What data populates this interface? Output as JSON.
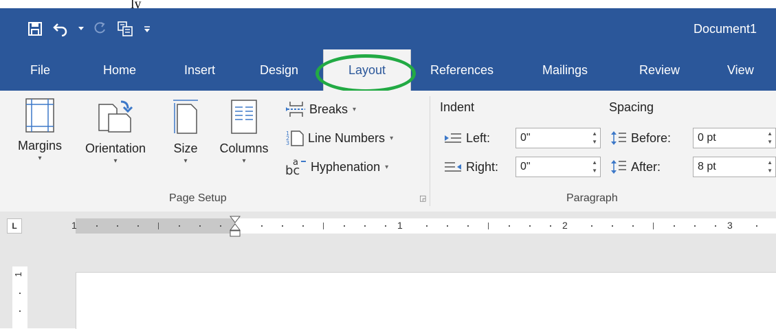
{
  "caption_fragment": "ly",
  "window": {
    "title": "Document1"
  },
  "tabs": [
    {
      "label": "File"
    },
    {
      "label": "Home"
    },
    {
      "label": "Insert"
    },
    {
      "label": "Design"
    },
    {
      "label": "Layout"
    },
    {
      "label": "References"
    },
    {
      "label": "Mailings"
    },
    {
      "label": "Review"
    },
    {
      "label": "View"
    }
  ],
  "active_tab": "Layout",
  "page_setup": {
    "margins": "Margins",
    "orientation": "Orientation",
    "size": "Size",
    "columns": "Columns",
    "breaks": "Breaks",
    "line_numbers": "Line Numbers",
    "hyphenation": "Hyphenation",
    "group_label": "Page Setup"
  },
  "paragraph": {
    "indent_header": "Indent",
    "spacing_header": "Spacing",
    "left_label": "Left:",
    "right_label": "Right:",
    "before_label": "Before:",
    "after_label": "After:",
    "left_value": "0\"",
    "right_value": "0\"",
    "before_value": "0 pt",
    "after_value": "8 pt",
    "group_label": "Paragraph"
  },
  "ruler": {
    "selector": "L",
    "numbers": [
      "1",
      "1",
      "2",
      "3"
    ],
    "vertical_number": "1"
  },
  "colors": {
    "accent": "#2b579a",
    "ribbon": "#f3f3f3",
    "highlight": "#22aa44"
  }
}
